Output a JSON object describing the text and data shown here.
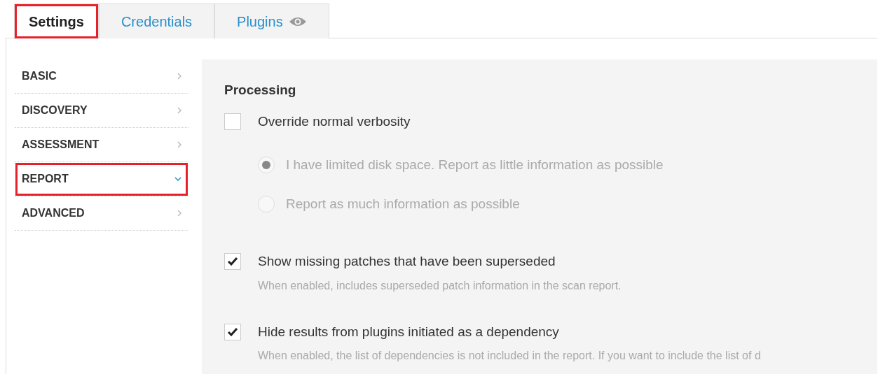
{
  "tabs": [
    {
      "label": "Settings",
      "selected": true,
      "highlighted": true,
      "kind": "text"
    },
    {
      "label": "Credentials",
      "selected": false,
      "highlighted": false,
      "kind": "text"
    },
    {
      "label": "Plugins",
      "selected": false,
      "highlighted": false,
      "kind": "watch"
    }
  ],
  "sidebar": {
    "items": [
      {
        "label": "BASIC",
        "expanded": false,
        "highlighted": false
      },
      {
        "label": "DISCOVERY",
        "expanded": false,
        "highlighted": false
      },
      {
        "label": "ASSESSMENT",
        "expanded": false,
        "highlighted": false
      },
      {
        "label": "REPORT",
        "expanded": true,
        "highlighted": true
      },
      {
        "label": "ADVANCED",
        "expanded": false,
        "highlighted": false
      }
    ]
  },
  "section": {
    "title": "Processing",
    "options": [
      {
        "kind": "checkbox",
        "label": "Override normal verbosity",
        "checked": false,
        "choices": [
          {
            "label": "I have limited disk space. Report as little information as possible",
            "selected": true,
            "disabled": true
          },
          {
            "label": "Report as much information as possible",
            "selected": false,
            "disabled": true
          }
        ]
      },
      {
        "kind": "checkbox",
        "label": "Show missing patches that have been superseded",
        "checked": true,
        "description": "When enabled, includes superseded patch information in the scan report."
      },
      {
        "kind": "checkbox",
        "label": "Hide results from plugins initiated as a dependency",
        "checked": true,
        "description": "When enabled, the list of dependencies is not included in the report. If you want to include the list of d"
      }
    ]
  }
}
